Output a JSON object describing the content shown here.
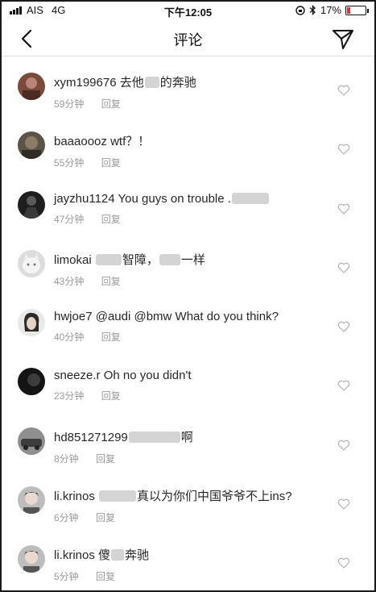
{
  "status_bar": {
    "carrier": "AIS",
    "network": "4G",
    "time": "下午12:05",
    "battery": "17%"
  },
  "header": {
    "back_icon": "chevron-left-icon",
    "title": "评论",
    "send_icon": "paper-plane-icon"
  },
  "colors": {
    "text": "#262626",
    "meta": "#9a9a9a",
    "divider": "#dcdcdc",
    "redacted": "#d4d4d4"
  },
  "comments": [
    {
      "username": "xym199676",
      "text_before": "去他",
      "text_after": "的奔驰",
      "time": "59分钟",
      "reply": "回复"
    },
    {
      "username": "baaaoooz",
      "text": "wtf？！",
      "time": "55分钟",
      "reply": "回复"
    },
    {
      "username": "jayzhu1124",
      "text": "You guys on trouble .",
      "time": "47分钟",
      "reply": "回复"
    },
    {
      "username": "limokai",
      "text_a": "智障，",
      "text_b": "一样",
      "time": "43分钟",
      "reply": "回复"
    },
    {
      "username": "hwjoe7",
      "text": "@audi @bmw What do you think?",
      "time": "40分钟",
      "reply": "回复"
    },
    {
      "username": "sneeze.r",
      "text": "Oh no you didn't",
      "time": "23分钟",
      "reply": "回复"
    },
    {
      "username": "hd851271299",
      "text_after": "啊",
      "time": "8分钟",
      "reply": "回复"
    },
    {
      "username": "li.krinos",
      "text_after": "真以为你们中国爷爷不上ins?",
      "time": "6分钟",
      "reply": "回复"
    },
    {
      "username": "li.krinos",
      "text_before": "傻",
      "text_after": "奔驰",
      "time": "5分钟",
      "reply": "回复"
    }
  ]
}
